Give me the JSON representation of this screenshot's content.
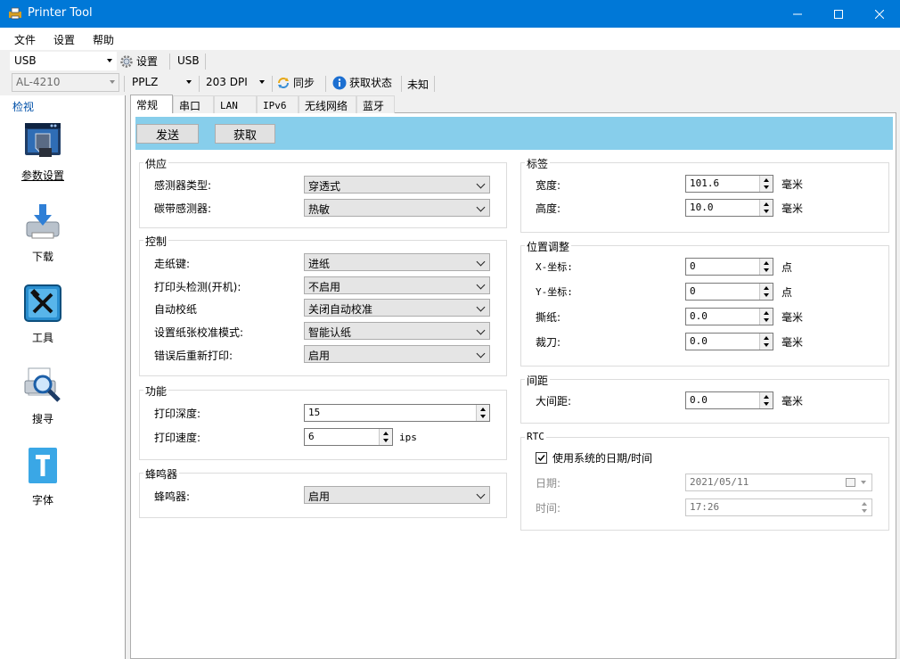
{
  "window": {
    "title": "Printer Tool"
  },
  "menu": {
    "items": [
      "文件",
      "设置",
      "帮助"
    ]
  },
  "toolbar1": {
    "port_combo": "USB",
    "settings_label": "设置",
    "port_label": "USB"
  },
  "toolbar2": {
    "model_combo": "AL-4210",
    "language_combo": "PPLZ",
    "dpi_combo": "203 DPI",
    "sync_label": "同步",
    "get_status_label": "获取状态",
    "status_value": "未知"
  },
  "leftnav": {
    "header": "检视",
    "items": [
      {
        "label": "参数设置",
        "icon": "settings-window-icon"
      },
      {
        "label": "下载",
        "icon": "download-printer-icon"
      },
      {
        "label": "工具",
        "icon": "tools-icon"
      },
      {
        "label": "搜寻",
        "icon": "search-magnifier-icon"
      },
      {
        "label": "字体",
        "icon": "font-t-icon"
      }
    ]
  },
  "tabs": [
    "常规",
    "串口",
    "LAN",
    "IPv6",
    "无线网络",
    "蓝牙"
  ],
  "actions": {
    "send": "发送",
    "get": "获取"
  },
  "supply": {
    "title": "供应",
    "sensor_type_label": "感测器类型:",
    "sensor_type_value": "穿透式",
    "ribbon_sensor_label": "碳带感测器:",
    "ribbon_sensor_value": "热敏"
  },
  "control": {
    "title": "控制",
    "feed_key_label": "走纸键:",
    "feed_key_value": "进纸",
    "head_check_label": "打印头检测(开机):",
    "head_check_value": "不启用",
    "auto_calib_label": "自动校纸",
    "auto_calib_value": "关闭自动校准",
    "calib_mode_label": "设置纸张校准模式:",
    "calib_mode_value": "智能认纸",
    "reprint_label": "错误后重新打印:",
    "reprint_value": "启用"
  },
  "function": {
    "title": "功能",
    "density_label": "打印深度:",
    "density_value": "15",
    "speed_label": "打印速度:",
    "speed_value": "6",
    "speed_unit": "ips"
  },
  "buzzer": {
    "title": "蜂鸣器",
    "buzzer_label": "蜂鸣器:",
    "buzzer_value": "启用"
  },
  "label": {
    "title": "标签",
    "width_label": "宽度:",
    "width_value": "101.6",
    "width_unit": "毫米",
    "height_label": "高度:",
    "height_value": "10.0",
    "height_unit": "毫米"
  },
  "position": {
    "title": "位置调整",
    "x_label": "X-坐标:",
    "x_value": "0",
    "x_unit": "点",
    "y_label": "Y-坐标:",
    "y_value": "0",
    "y_unit": "点",
    "tear_label": "撕纸:",
    "tear_value": "0.0",
    "tear_unit": "毫米",
    "cutter_label": "裁刀:",
    "cutter_value": "0.0",
    "cutter_unit": "毫米"
  },
  "gap": {
    "title": "间距",
    "gap_label": "大间距:",
    "gap_value": "0.0",
    "gap_unit": "毫米"
  },
  "rtc": {
    "title": "RTC",
    "use_system_label": "使用系统的日期/时间",
    "use_system_checked": true,
    "date_label": "日期:",
    "date_value": "2021/05/11",
    "time_label": "时间:",
    "time_value": "17:26"
  },
  "colors": {
    "titlebar": "#0078d7",
    "actionbar": "#87ceeb",
    "nav_header": "#0050a8"
  }
}
